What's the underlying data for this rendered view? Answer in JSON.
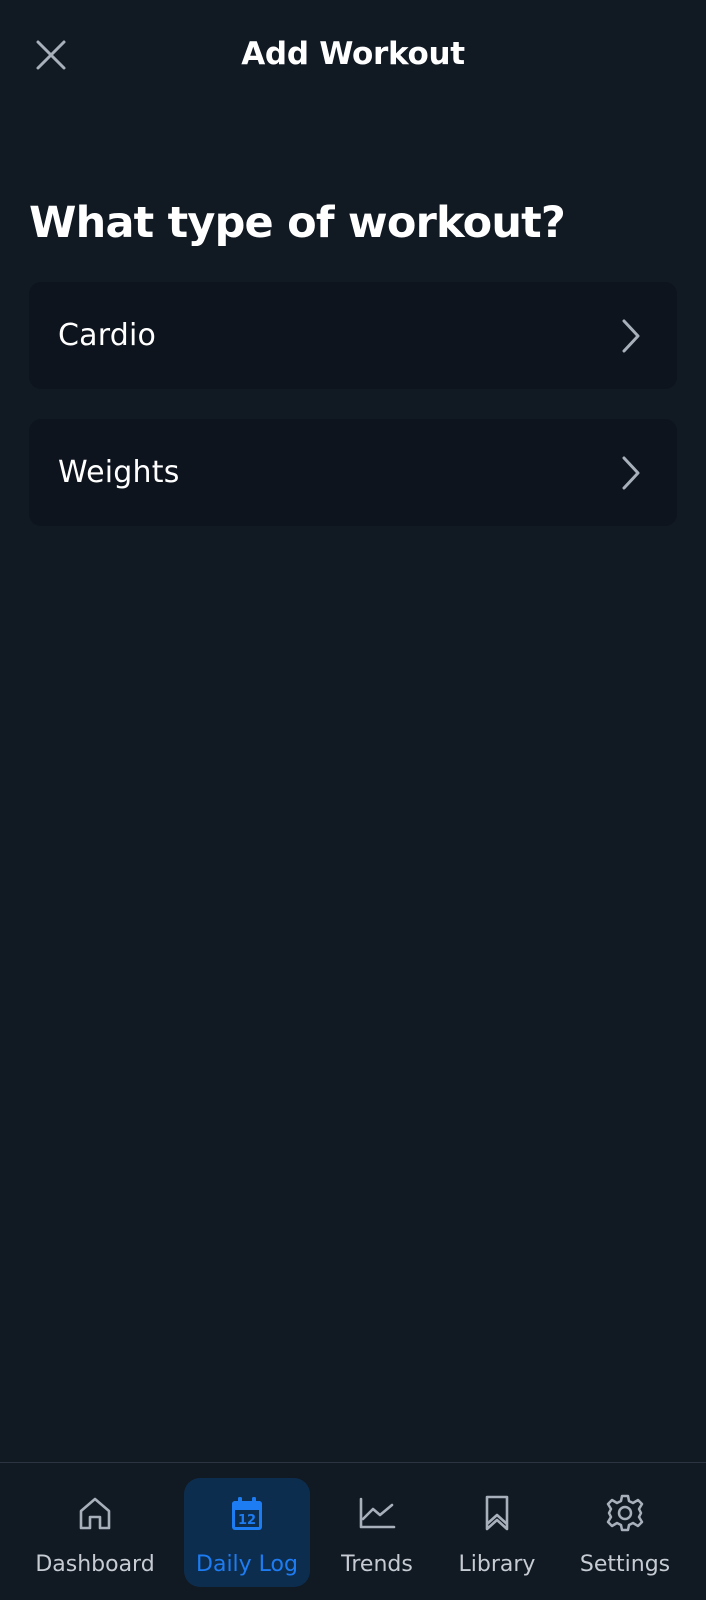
{
  "header": {
    "title": "Add Workout",
    "close_icon": "close-icon"
  },
  "main": {
    "question": "What type of workout?",
    "options": [
      {
        "label": "Cardio",
        "icon": "chevron-right-icon"
      },
      {
        "label": "Weights",
        "icon": "chevron-right-icon"
      }
    ]
  },
  "bottom_nav": {
    "active": "Daily Log",
    "items": [
      {
        "label": "Dashboard",
        "icon": "home-icon"
      },
      {
        "label": "Daily Log",
        "icon": "calendar-icon",
        "icon_text": "12"
      },
      {
        "label": "Trends",
        "icon": "trend-chart-icon"
      },
      {
        "label": "Library",
        "icon": "bookmark-icon"
      },
      {
        "label": "Settings",
        "icon": "gear-icon"
      }
    ]
  },
  "colors": {
    "background": "#111923",
    "card_background": "#0d141d",
    "active_nav_background": "#0d2d4e",
    "accent": "#1d7cf2",
    "text_primary": "#ffffff",
    "text_secondary": "#c7ccd3",
    "icon_muted": "#a8b0bb"
  }
}
